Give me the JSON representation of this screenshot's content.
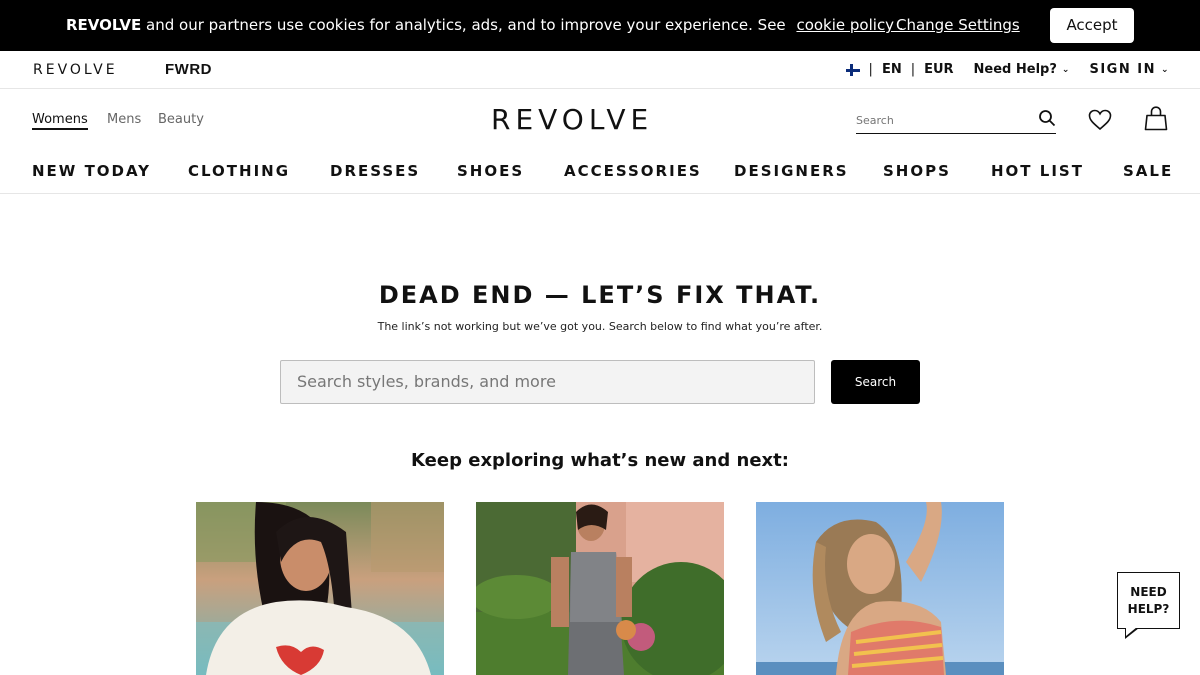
{
  "cookie_bar": {
    "brand": "REVOLVE",
    "message": "and our partners use cookies for analytics, ads, and to improve your experience.  See",
    "link_label": "cookie policy .",
    "change_settings_label": "Change Settings",
    "accept_label": "Accept"
  },
  "utility_bar": {
    "revolve_label": "REVOLVE",
    "fwrd_label": "FWRD",
    "sep": "|",
    "language": "EN",
    "currency": "EUR",
    "need_help_label": "Need Help?",
    "sign_in_label": "SIGN IN"
  },
  "header": {
    "genders": [
      "Womens",
      "Mens",
      "Beauty"
    ],
    "active_gender": "Womens",
    "logo": "REVOLVE",
    "search_placeholder": "Search"
  },
  "main_nav": [
    "NEW TODAY",
    "CLOTHING",
    "DRESSES",
    "SHOES",
    "ACCESSORIES",
    "DESIGNERS",
    "SHOPS",
    "HOT LIST",
    "SALE"
  ],
  "dead_end": {
    "title": "DEAD END — LET’S FIX THAT.",
    "subtitle": "The link’s not working but we’ve got you. Search below to find what you’re after.",
    "search_placeholder": "Search styles, brands, and more",
    "search_button": "Search",
    "explore_heading": "Keep exploring what’s new and next:"
  },
  "help_bubble": {
    "line1": "NEED",
    "line2": "HELP?"
  },
  "colors": {
    "cookie_bar_bg": "#000000",
    "accent": "#000000",
    "search_field_bg": "#f3f3f3"
  }
}
